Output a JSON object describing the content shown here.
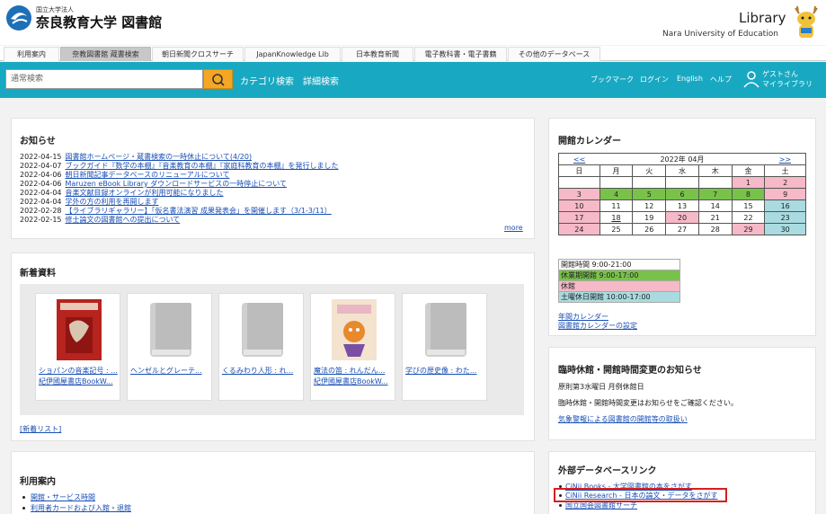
{
  "header": {
    "uni_small": "国立大学法人",
    "uni_name": "奈良教育大学 図書館",
    "lib_en": "Library",
    "lib_en_sub": "Nara University of Education"
  },
  "topnav": [
    {
      "label": "利用案内"
    },
    {
      "label": "奈教図書館 蔵書検索"
    },
    {
      "label": "朝日新聞クロスサーチ"
    },
    {
      "label": "JapanKnowledge Lib"
    },
    {
      "label": "日本教育新聞"
    },
    {
      "label": "電子教科書・電子書籍"
    },
    {
      "label": "その他のデータベース"
    }
  ],
  "search": {
    "placeholder": "通常検索",
    "category_link": "カテゴリ検索",
    "detail_link": "詳細検索",
    "right_links": [
      "ブックマーク",
      "ログイン",
      "English",
      "ヘルプ"
    ],
    "user_line1": "ゲストさん",
    "user_line2": "マイライブラリ"
  },
  "news": {
    "title": "お知らせ",
    "items": [
      {
        "date": "2022-04-15",
        "text": "図書館ホームページ・蔵書検索の一時休止について(4/20)"
      },
      {
        "date": "2022-04-07",
        "text": "ブックガイド『数学の本棚』『音楽教育の本棚』『家庭科教育の本棚』を発行しました"
      },
      {
        "date": "2022-04-06",
        "text": "朝日新聞記事データベースのリニューアルについて"
      },
      {
        "date": "2022-04-06",
        "text": "Maruzen eBook Library ダウンロードサービスの一時停止について"
      },
      {
        "date": "2022-04-04",
        "text": "音楽文献目録オンラインが利用可能になりました"
      },
      {
        "date": "2022-04-04",
        "text": "学外の方の利用を再開します"
      },
      {
        "date": "2022-02-28",
        "text": "【ライブラリギャラリー】「仮名書法演習 成果発表会」を開催します（3/1-3/11）"
      },
      {
        "date": "2022-02-15",
        "text": "修士論文の図書館への提出について"
      }
    ],
    "more": "more"
  },
  "newbooks": {
    "title": "新着資料",
    "books": [
      {
        "title": "ショパンの音楽記号 : ...",
        "pub": "紀伊國屋書店BookW..."
      },
      {
        "title": "ヘンゼルとグレーテ...",
        "pub": ""
      },
      {
        "title": "くるみわり人形 : れ...",
        "pub": ""
      },
      {
        "title": "魔法の笛 : れんだん...",
        "pub": "紀伊國屋書店BookW..."
      },
      {
        "title": "学びの歴史像 : わた...",
        "pub": ""
      }
    ],
    "list_link": "[新着リスト]"
  },
  "guide": {
    "title": "利用案内",
    "items": [
      "開館・サービス時間",
      "利用者カードおよび入館・退館"
    ]
  },
  "calendar": {
    "title": "開館カレンダー",
    "prev": "<<",
    "next": ">>",
    "month": "2022年 04月",
    "weekdays": [
      "日",
      "月",
      "火",
      "水",
      "木",
      "金",
      "土"
    ],
    "weeks": [
      [
        [
          "",
          "w"
        ],
        [
          "",
          "w"
        ],
        [
          "",
          "w"
        ],
        [
          "",
          "w"
        ],
        [
          "",
          "w"
        ],
        [
          "1",
          "p"
        ],
        [
          "2",
          "p"
        ]
      ],
      [
        [
          "3",
          "p"
        ],
        [
          "4",
          "g"
        ],
        [
          "5",
          "g"
        ],
        [
          "6",
          "g"
        ],
        [
          "7",
          "g"
        ],
        [
          "8",
          "g"
        ],
        [
          "9",
          "p"
        ]
      ],
      [
        [
          "10",
          "p"
        ],
        [
          "11",
          "w"
        ],
        [
          "12",
          "w"
        ],
        [
          "13",
          "w"
        ],
        [
          "14",
          "w"
        ],
        [
          "15",
          "w"
        ],
        [
          "16",
          "b"
        ]
      ],
      [
        [
          "17",
          "p"
        ],
        [
          "18",
          "t"
        ],
        [
          "19",
          "w"
        ],
        [
          "20",
          "p"
        ],
        [
          "21",
          "w"
        ],
        [
          "22",
          "w"
        ],
        [
          "23",
          "b"
        ]
      ],
      [
        [
          "24",
          "p"
        ],
        [
          "25",
          "w"
        ],
        [
          "26",
          "w"
        ],
        [
          "27",
          "w"
        ],
        [
          "28",
          "w"
        ],
        [
          "29",
          "p"
        ],
        [
          "30",
          "b"
        ]
      ]
    ],
    "legend": [
      {
        "label": "開館時間 9:00-21:00",
        "color": "#ffffff"
      },
      {
        "label": "休業期開館 9:00-17:00",
        "color": "#79c24a"
      },
      {
        "label": "休館",
        "color": "#f6b9c7"
      },
      {
        "label": "土曜休日開館 10:00-17:00",
        "color": "#a9dbe0"
      }
    ],
    "links": [
      "年間カレンダー",
      "図書館カレンダーの設定"
    ]
  },
  "closure": {
    "title": "臨時休館・開館時間変更のお知らせ",
    "line1": "原則第3水曜日 月例休館日",
    "line2": "臨時休館・開館時間変更はお知らせをご確認ください。",
    "link": "気象警報による図書館の開館等の取扱い"
  },
  "external": {
    "title": "外部データベースリンク",
    "items": [
      "CiNii Books - 大学図書館の本をさがす",
      "CiNii Research - 日本の論文・データをさがす",
      "国立国会図書館サーチ"
    ]
  }
}
